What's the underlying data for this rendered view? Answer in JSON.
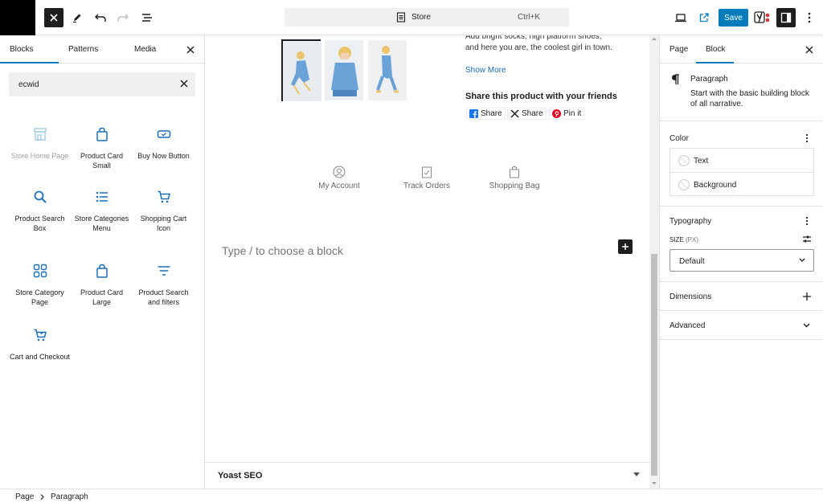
{
  "topbar": {
    "command_title": "Store",
    "command_shortcut": "Ctrl+K",
    "save_label": "Save",
    "icons": [
      "close-icon",
      "pen-icon",
      "undo-icon",
      "redo-icon",
      "list-view-icon",
      "document-icon",
      "desktop-preview-icon",
      "external-link-icon",
      "yoast-icon",
      "settings-panel-icon",
      "more-vertical-icon"
    ]
  },
  "inserter": {
    "tabs": [
      "Blocks",
      "Patterns",
      "Media"
    ],
    "search_value": "ecwid",
    "blocks": [
      {
        "label": "Store Home Page",
        "icon": "store-home-icon",
        "disabled": true
      },
      {
        "label": "Product Card Small",
        "icon": "shopping-bag-icon",
        "disabled": false
      },
      {
        "label": "Buy Now Button",
        "icon": "buy-button-icon",
        "disabled": false
      },
      {
        "label": "Product Search Box",
        "icon": "search-icon",
        "disabled": false
      },
      {
        "label": "Store Categories Menu",
        "icon": "list-icon",
        "disabled": false
      },
      {
        "label": "Shopping Cart Icon",
        "icon": "cart-icon",
        "disabled": false
      },
      {
        "label": "Store Category Page",
        "icon": "grid-icon",
        "disabled": false
      },
      {
        "label": "Product Card Large",
        "icon": "shopping-bag-icon",
        "disabled": false
      },
      {
        "label": "Product Search and filters",
        "icon": "filter-icon",
        "disabled": false
      },
      {
        "label": "Cart and Checkout",
        "icon": "cart-icon",
        "disabled": false
      }
    ],
    "accent_color": "#007cba",
    "icon_color": "#1d6fb8"
  },
  "canvas": {
    "description_line1": "Add bright socks, high platform shoes,",
    "description_line2": "and here you are, the coolest girl in town.",
    "show_more": "Show More",
    "share_title": "Share this product with your friends",
    "share_buttons": [
      "Share",
      "Share",
      "Pin it"
    ],
    "account_links": [
      "My Account",
      "Track Orders",
      "Shopping Bag"
    ],
    "placeholder": "Type / to choose a block",
    "yoast_label": "Yoast SEO"
  },
  "sidebar": {
    "tabs": [
      "Page",
      "Block"
    ],
    "block_name": "Paragraph",
    "block_desc_line1": "Start with the basic building block",
    "block_desc_line2": "of all narrative.",
    "color_title": "Color",
    "color_items": [
      "Text",
      "Background"
    ],
    "typography_title": "Typography",
    "size_label": "SIZE",
    "size_unit": "(PX)",
    "size_value": "Default",
    "dimensions_title": "Dimensions",
    "advanced_title": "Advanced"
  },
  "breadcrumb": [
    "Page",
    "Paragraph"
  ]
}
